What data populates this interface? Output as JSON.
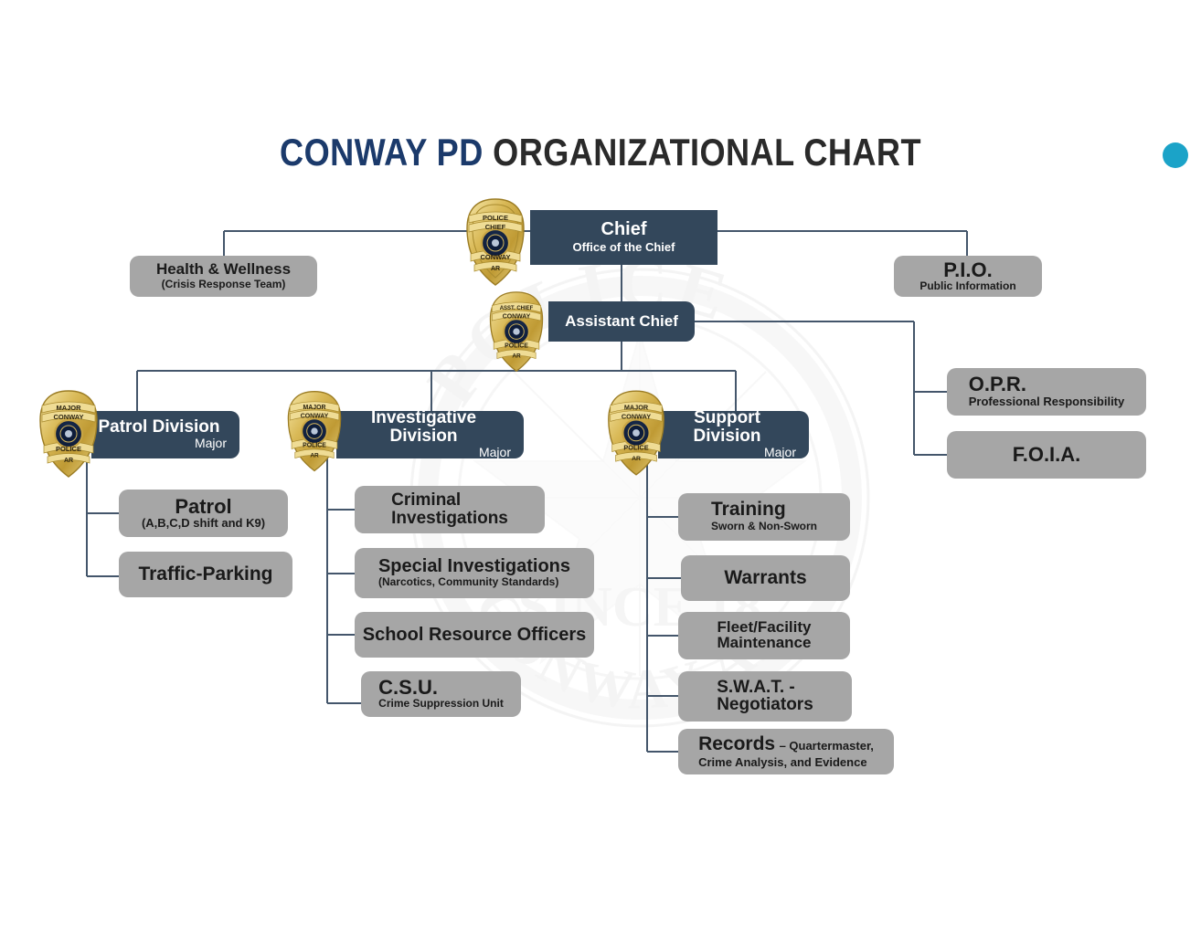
{
  "title": {
    "part1": "CONWAY PD ",
    "part2": "ORGANIZATIONAL CHART"
  },
  "colors": {
    "navy_box": "#33475b",
    "gray_box": "#a6a6a6",
    "title_navy": "#1b3a6b",
    "title_dark": "#2a2a2a",
    "accent_dot": "#1ba3c8",
    "line": "#44566b"
  },
  "watermark": {
    "top_text": "POLICE",
    "mid_text": "CONWAY AR",
    "bottom_text": "SINCE 18"
  },
  "nodes": {
    "chief": {
      "title": "Chief",
      "subtitle": "Office of the Chief",
      "badge": "police-chief-badge"
    },
    "assistant_chief": {
      "title": "Assistant Chief",
      "badge": "asst-chief-badge"
    },
    "health_wellness": {
      "title": "Health & Wellness",
      "subtitle": "(Crisis Response Team)"
    },
    "pio": {
      "title": "P.I.O.",
      "subtitle": "Public Information"
    },
    "opr": {
      "title": "O.P.R.",
      "subtitle": "Professional Responsibility"
    },
    "foia": {
      "title": "F.O.I.A.",
      "subtitle": ""
    }
  },
  "divisions": [
    {
      "key": "patrol",
      "title": "Patrol Division",
      "rank": "Major",
      "badge": "major-badge",
      "children": [
        {
          "title": "Patrol",
          "subtitle": "(A,B,C,D shift and K9)"
        },
        {
          "title": "Traffic-Parking",
          "subtitle": ""
        }
      ]
    },
    {
      "key": "investigative",
      "title": "Investigative Division",
      "rank": "Major",
      "badge": "major-badge",
      "children": [
        {
          "title": "Criminal\nInvestigations",
          "subtitle": ""
        },
        {
          "title": "Special Investigations",
          "subtitle": "(Narcotics, Community Standards)"
        },
        {
          "title": "School Resource Officers",
          "subtitle": ""
        },
        {
          "title": "C.S.U.",
          "subtitle": "Crime Suppression Unit"
        }
      ]
    },
    {
      "key": "support",
      "title": "Support Division",
      "rank": "Major",
      "badge": "major-badge",
      "children": [
        {
          "title": "Training",
          "subtitle": "Sworn & Non-Sworn"
        },
        {
          "title": "Warrants",
          "subtitle": ""
        },
        {
          "title": "Fleet/Facility\nMaintenance",
          "subtitle": ""
        },
        {
          "title": "S.W.A.T. -\nNegotiators",
          "subtitle": ""
        },
        {
          "title": "Records",
          "subtitle": "– Quartermaster,",
          "subtitle2": "Crime Analysis, and Evidence"
        }
      ]
    }
  ],
  "badge_labels": {
    "chief": [
      "POLICE",
      "CHIEF",
      "CONWAY",
      "AR"
    ],
    "asst": [
      "ASST. CHIEF",
      "CONWAY",
      "POLICE",
      "AR"
    ],
    "major": [
      "MAJOR",
      "CONWAY",
      "POLICE",
      "AR"
    ]
  }
}
